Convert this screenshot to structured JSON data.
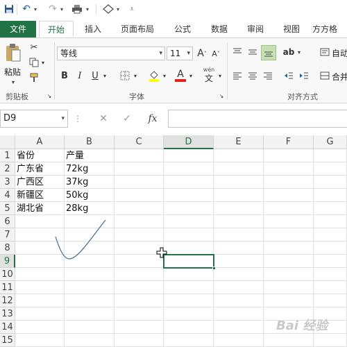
{
  "ribbon_tabs": {
    "file": "文件",
    "home": "开始",
    "insert": "插入",
    "layout": "页面布局",
    "formulas": "公式",
    "data": "数据",
    "review": "审阅",
    "view": "视图",
    "fangfang": "方方格"
  },
  "clipboard": {
    "paste_label": "粘贴",
    "group_label": "剪贴板"
  },
  "font": {
    "family_value": "等线",
    "size_value": "11",
    "bold": "B",
    "italic": "I",
    "underline": "U",
    "grow": "A",
    "shrink": "A",
    "font_color_glyph": "A",
    "wen": "wén",
    "wen_char": "文",
    "group_label": "字体"
  },
  "alignment": {
    "wrap_label": "自动",
    "merge_label": "合并",
    "group_label": "对齐方式"
  },
  "formula_bar": {
    "name_box": "D9",
    "cancel_glyph": "✕",
    "enter_glyph": "✓",
    "fx_glyph": "fx",
    "formula": ""
  },
  "sheet": {
    "columns": [
      "A",
      "B",
      "C",
      "D",
      "E",
      "F",
      "G"
    ],
    "selected_column": "D",
    "rows": [
      "1",
      "2",
      "3",
      "4",
      "5",
      "6",
      "7",
      "8",
      "9",
      "10",
      "11",
      "12",
      "13",
      "14",
      "15"
    ],
    "selected_row": "9",
    "cells": {
      "A1": "省份",
      "B1": "产量",
      "A2": "广东省",
      "B2": "72kg",
      "A3": "广西区",
      "B3": "37kg",
      "A4": "新疆区",
      "B4": "50kg",
      "A5": "湖北省",
      "B5": "28kg"
    },
    "active_cell": "D9"
  },
  "watermark": "Bai 经验"
}
